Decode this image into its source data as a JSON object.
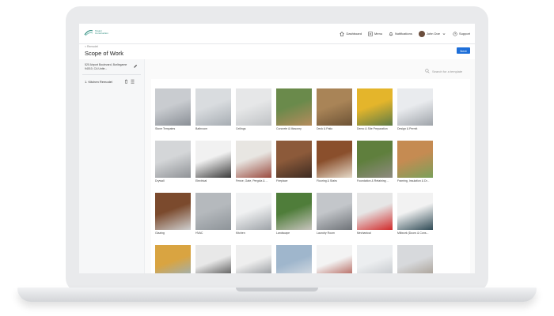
{
  "header": {
    "logo_line1": "Tosani",
    "logo_line2": "Construction",
    "nav": [
      {
        "label": "Dashboard",
        "icon": "home-icon"
      },
      {
        "label": "Menu",
        "icon": "menu-icon"
      },
      {
        "label": "Notifications",
        "icon": "bell-icon"
      }
    ],
    "user_name": "John Doe",
    "support_label": "Support"
  },
  "page": {
    "breadcrumb": "< Remodel",
    "title": "Scope of Work",
    "next_label": "Next"
  },
  "sidebar": {
    "address": "520 Airport Boulevard, Burlingame 94010, CA Unite...",
    "room": "1. Kitchen Remodel"
  },
  "search": {
    "placeholder": "Search for a template"
  },
  "templates": [
    {
      "label": "Stone Tempates",
      "colors": [
        "#c9ccd0",
        "#8a8f96"
      ]
    },
    {
      "label": "Bathroom",
      "colors": [
        "#d9dcdf",
        "#a7adb3"
      ]
    },
    {
      "label": "Ceilings",
      "colors": [
        "#e6e7e8",
        "#bfc2c5"
      ]
    },
    {
      "label": "Concrete & Masonry",
      "colors": [
        "#6a8a4b",
        "#b58b5c"
      ]
    },
    {
      "label": "Deck & Patio",
      "colors": [
        "#a98457",
        "#6d5336"
      ]
    },
    {
      "label": "Demo & Site Preparation",
      "colors": [
        "#e4b52b",
        "#5e7c46"
      ]
    },
    {
      "label": "Design & Permit",
      "colors": [
        "#e9ebee",
        "#9fa4aa"
      ]
    },
    {
      "label": "Drywall",
      "colors": [
        "#d4d6d8",
        "#8f9296"
      ]
    },
    {
      "label": "Electrical",
      "colors": [
        "#f1f1f1",
        "#3b3b3b"
      ]
    },
    {
      "label": "Fence, Gate, Pergola & ...",
      "colors": [
        "#e8e6e2",
        "#9a4b3f"
      ]
    },
    {
      "label": "Fireplace",
      "colors": [
        "#8c5a3a",
        "#3d2b22"
      ]
    },
    {
      "label": "Flooring & Stairs",
      "colors": [
        "#8a4f2c",
        "#e5d9c8"
      ]
    },
    {
      "label": "Foundation & Retaining ...",
      "colors": [
        "#5f7f3d",
        "#8f8a80"
      ]
    },
    {
      "label": "Framing, Insulation & Dr...",
      "colors": [
        "#c58b52",
        "#7aa05a"
      ]
    },
    {
      "label": "Glazing",
      "colors": [
        "#7b4a2d",
        "#cfcfcf"
      ]
    },
    {
      "label": "HVAC",
      "colors": [
        "#b5b9bd",
        "#8e9499"
      ]
    },
    {
      "label": "Kitchen",
      "colors": [
        "#f0f1f2",
        "#9ea3a8"
      ]
    },
    {
      "label": "Landscape",
      "colors": [
        "#4f7d3a",
        "#c7c4bd"
      ]
    },
    {
      "label": "Laundry Room",
      "colors": [
        "#c3c6ca",
        "#6f7378"
      ]
    },
    {
      "label": "Mechanical",
      "colors": [
        "#e6e6e6",
        "#d12a2a"
      ]
    },
    {
      "label": "Millwork (Doors & Cons...",
      "colors": [
        "#f2f2f2",
        "#2f4a55"
      ]
    },
    {
      "label": "",
      "colors": [
        "#d9a441",
        "#8db4d6"
      ]
    },
    {
      "label": "",
      "colors": [
        "#e8e8e8",
        "#2a2a2a"
      ]
    },
    {
      "label": "",
      "colors": [
        "#eeeeee",
        "#7a7f85"
      ]
    },
    {
      "label": "",
      "colors": [
        "#9fb6cc",
        "#e3e5e8"
      ]
    },
    {
      "label": "",
      "colors": [
        "#f3f3f3",
        "#a0382d"
      ]
    },
    {
      "label": "",
      "colors": [
        "#eceef0",
        "#b9bdc2"
      ]
    },
    {
      "label": "",
      "colors": [
        "#d7d9dc",
        "#9a8e80"
      ]
    }
  ]
}
